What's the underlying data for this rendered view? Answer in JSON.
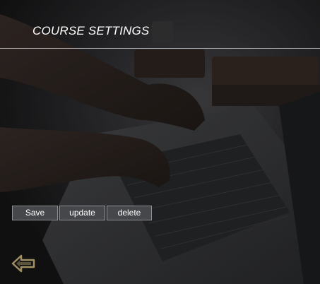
{
  "header": {
    "title": "COURSE SETTINGS"
  },
  "actions": {
    "save_label": "Save",
    "update_label": "update",
    "delete_label": "delete"
  },
  "navigation": {
    "back_icon": "arrow-left-icon"
  },
  "colors": {
    "background": "#1c1c1e",
    "button_fill": "#45474a",
    "button_border": "#8d8f93",
    "header_rule": "#a9a9a9",
    "back_icon": "#a08f63"
  }
}
